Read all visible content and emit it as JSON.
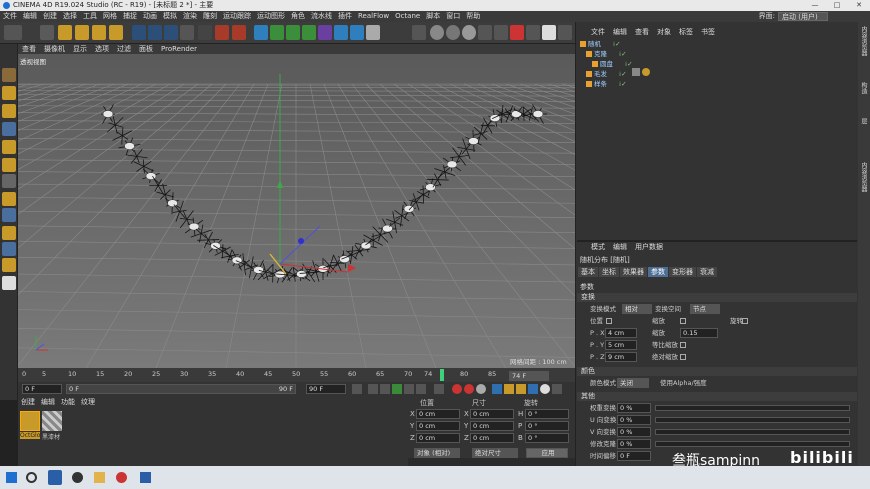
{
  "window": {
    "title": "CINEMA 4D R19.024 Studio (RC - R19) - [未标题 2 *] - 主要",
    "controls": [
      "—",
      "□",
      "✕"
    ]
  },
  "menubar": [
    "文件",
    "编辑",
    "创建",
    "选择",
    "工具",
    "网格",
    "捕捉",
    "动画",
    "模拟",
    "渲染",
    "雕刻",
    "运动跟踪",
    "运动图形",
    "角色",
    "流水线",
    "插件",
    "RealFlow",
    "Octane",
    "脚本",
    "窗口",
    "帮助"
  ],
  "layout": {
    "label": "界面:",
    "value": "启动 (用户)"
  },
  "viewport": {
    "menu": [
      "查看",
      "摄像机",
      "显示",
      "选项",
      "过滤",
      "面板",
      "ProRender"
    ],
    "label": "透视视图",
    "grid_info": "网格间距 : 100 cm"
  },
  "timeline": {
    "ticks": [
      "0",
      "5",
      "10",
      "15",
      "20",
      "25",
      "30",
      "35",
      "40",
      "45",
      "50",
      "55",
      "60",
      "65",
      "70",
      "74",
      "80",
      "85",
      "90"
    ],
    "current": "74 F",
    "playhead": 74,
    "max": 90,
    "start_field": "0 F",
    "end_field": "90 F",
    "end_field2": "90 F",
    "start_field2": "0 F"
  },
  "materials": {
    "menu": [
      "创建",
      "编辑",
      "功能",
      "纹理"
    ],
    "items": [
      {
        "name": "OctGlo"
      },
      {
        "name": "黑漆材"
      }
    ]
  },
  "coords": {
    "headers": [
      "位置",
      "尺寸",
      "旋转"
    ],
    "rows": [
      {
        "axis": "X",
        "pos": "0 cm",
        "size": "0 cm",
        "rot_label": "H",
        "rot": "0 °"
      },
      {
        "axis": "Y",
        "pos": "0 cm",
        "size": "0 cm",
        "rot_label": "P",
        "rot": "0 °"
      },
      {
        "axis": "Z",
        "pos": "0 cm",
        "size": "0 cm",
        "rot_label": "B",
        "rot": "0 °"
      }
    ],
    "mode": "对象 (相对)",
    "size_mode": "绝对尺寸",
    "apply": "应用"
  },
  "objects": {
    "menu": [
      "文件",
      "编辑",
      "查看",
      "对象",
      "标签",
      "书签"
    ],
    "items": [
      {
        "name": "随机",
        "indent": 0
      },
      {
        "name": "克隆",
        "indent": 1
      },
      {
        "name": "圆盘",
        "indent": 2
      },
      {
        "name": "毛发",
        "indent": 1
      },
      {
        "name": "样条",
        "indent": 1
      }
    ]
  },
  "attributes": {
    "menu": [
      "模式",
      "编辑",
      "用户数据"
    ],
    "title": "随机分布 [随机]",
    "tabs": [
      "基本",
      "坐标",
      "效果器",
      "参数",
      "变形器",
      "衰减"
    ],
    "active_tab": "参数",
    "section_params": "参数",
    "transform_section": "变换",
    "transform_mode_label": "变换模式",
    "transform_mode": "相对",
    "transform_space_label": "变换空间",
    "transform_space": "节点",
    "pos_label": "位置",
    "scale_label": "缩放",
    "rot_label": "旋转",
    "px_label": "P . X",
    "px": "4 cm",
    "py_label": "P . Y",
    "py": "5 cm",
    "pz_label": "P . Z",
    "pz": "9 cm",
    "scale_value_label": "缩放",
    "scale_value": "0.15",
    "uniform_label": "等比缩放",
    "abs_scale_label": "绝对缩放",
    "color_section": "颜色",
    "color_mode_label": "颜色模式",
    "color_mode": "关闭",
    "use_alpha_label": "使用Alpha/强度",
    "other_section": "其他",
    "weight_label": "权重变换",
    "weight": "0 %",
    "u_label": "U 向变换",
    "u": "0 %",
    "v_label": "V 向变换",
    "v": "0 %",
    "mod_label": "修改克隆",
    "mod": "0 %",
    "time_label": "时间偏移",
    "time": "0 F"
  },
  "side_tabs": [
    "内容浏览器",
    "构造",
    "层",
    "内容浏览器"
  ],
  "watermark": "叁瓶sampinn",
  "bili": "bilibili"
}
